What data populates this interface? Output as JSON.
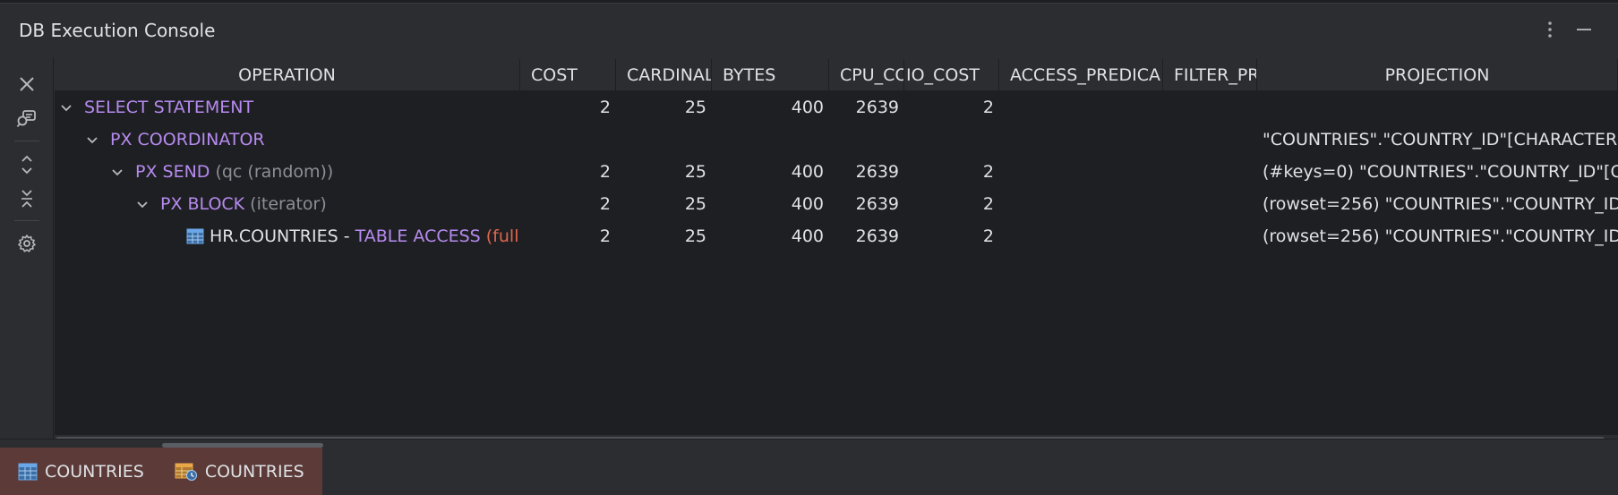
{
  "window": {
    "title": "DB Execution Console"
  },
  "columns": [
    "OPERATION",
    "COST",
    "CARDINAL",
    "BYTES",
    "CPU_CO",
    "IO_COST",
    "ACCESS_PREDICA",
    "FILTER_PR",
    "PROJECTION"
  ],
  "rows": [
    {
      "op_keyword": "SELECT STATEMENT",
      "op_detail": "",
      "cost": "2",
      "cardinality": "25",
      "bytes": "400",
      "cpu_cost": "2639",
      "io_cost": "2",
      "projection": ""
    },
    {
      "op_keyword": "PX COORDINATOR",
      "op_detail": "",
      "cost": "",
      "cardinality": "",
      "bytes": "",
      "cpu_cost": "",
      "io_cost": "",
      "projection": "\"COUNTRIES\".\"COUNTRY_ID\"[CHARACTER"
    },
    {
      "op_keyword": "PX SEND",
      "op_detail": " (qc (random))",
      "cost": "2",
      "cardinality": "25",
      "bytes": "400",
      "cpu_cost": "2639",
      "io_cost": "2",
      "projection": "(#keys=0) \"COUNTRIES\".\"COUNTRY_ID\"[C"
    },
    {
      "op_keyword": "PX BLOCK",
      "op_detail": " (iterator)",
      "cost": "2",
      "cardinality": "25",
      "bytes": "400",
      "cpu_cost": "2639",
      "io_cost": "2",
      "projection": "(rowset=256) \"COUNTRIES\".\"COUNTRY_ID"
    },
    {
      "op_table": "HR.COUNTRIES - ",
      "op_keyword": "TABLE ACCESS",
      "op_full": " (full",
      "cost": "2",
      "cardinality": "25",
      "bytes": "400",
      "cpu_cost": "2639",
      "io_cost": "2",
      "projection": "(rowset=256) \"COUNTRIES\".\"COUNTRY_ID"
    }
  ],
  "bottom_tabs": [
    {
      "label": "COUNTRIES",
      "icon": "table-icon"
    },
    {
      "label": "COUNTRIES",
      "icon": "table-history-icon"
    }
  ],
  "colors": {
    "keyword": "#b68bf0",
    "detail": "#8c8f96",
    "full": "#e0664f",
    "tab_bg": "#5b3a38"
  }
}
